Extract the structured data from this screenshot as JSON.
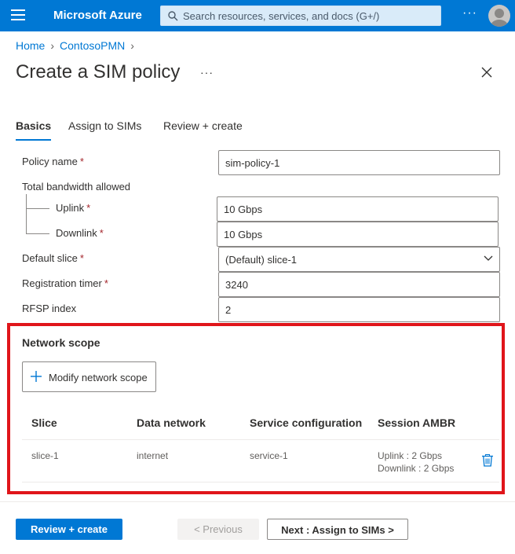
{
  "app": {
    "brand": "Microsoft Azure"
  },
  "search": {
    "placeholder": "Search resources, services, and docs (G+/)"
  },
  "breadcrumb": {
    "home": "Home",
    "item": "ContosoPMN"
  },
  "page": {
    "title": "Create a SIM policy",
    "more": "···"
  },
  "tabs": [
    {
      "label": "Basics",
      "active": true
    },
    {
      "label": "Assign to SIMs",
      "active": false
    },
    {
      "label": "Review + create",
      "active": false
    }
  ],
  "form": {
    "policy_name": {
      "label": "Policy name",
      "required": "*",
      "value": "sim-policy-1"
    },
    "bandwidth": {
      "label": "Total bandwidth allowed"
    },
    "uplink": {
      "label": "Uplink",
      "required": "*",
      "value": "10 Gbps"
    },
    "downlink": {
      "label": "Downlink",
      "required": "*",
      "value": "10 Gbps"
    },
    "default_slice": {
      "label": "Default slice",
      "required": "*",
      "value": "(Default) slice-1"
    },
    "registration_timer": {
      "label": "Registration timer",
      "required": "*",
      "value": "3240"
    },
    "rfsp_index": {
      "label": "RFSP index",
      "value": "2"
    }
  },
  "network_scope": {
    "title": "Network scope",
    "modify_label": "Modify network scope",
    "columns": [
      "Slice",
      "Data network",
      "Service configuration",
      "Session AMBR"
    ],
    "rows": [
      {
        "slice": "slice-1",
        "data_network": "internet",
        "service_configuration": "service-1",
        "ambr_uplink": "Uplink : 2 Gbps",
        "ambr_downlink": "Downlink : 2 Gbps"
      }
    ]
  },
  "footer": {
    "review_create": "Review + create",
    "previous": "< Previous",
    "next": "Next : Assign to SIMs >"
  },
  "colors": {
    "accent": "#0078d4",
    "highlight": "#e0151a",
    "required": "#a4262c"
  }
}
